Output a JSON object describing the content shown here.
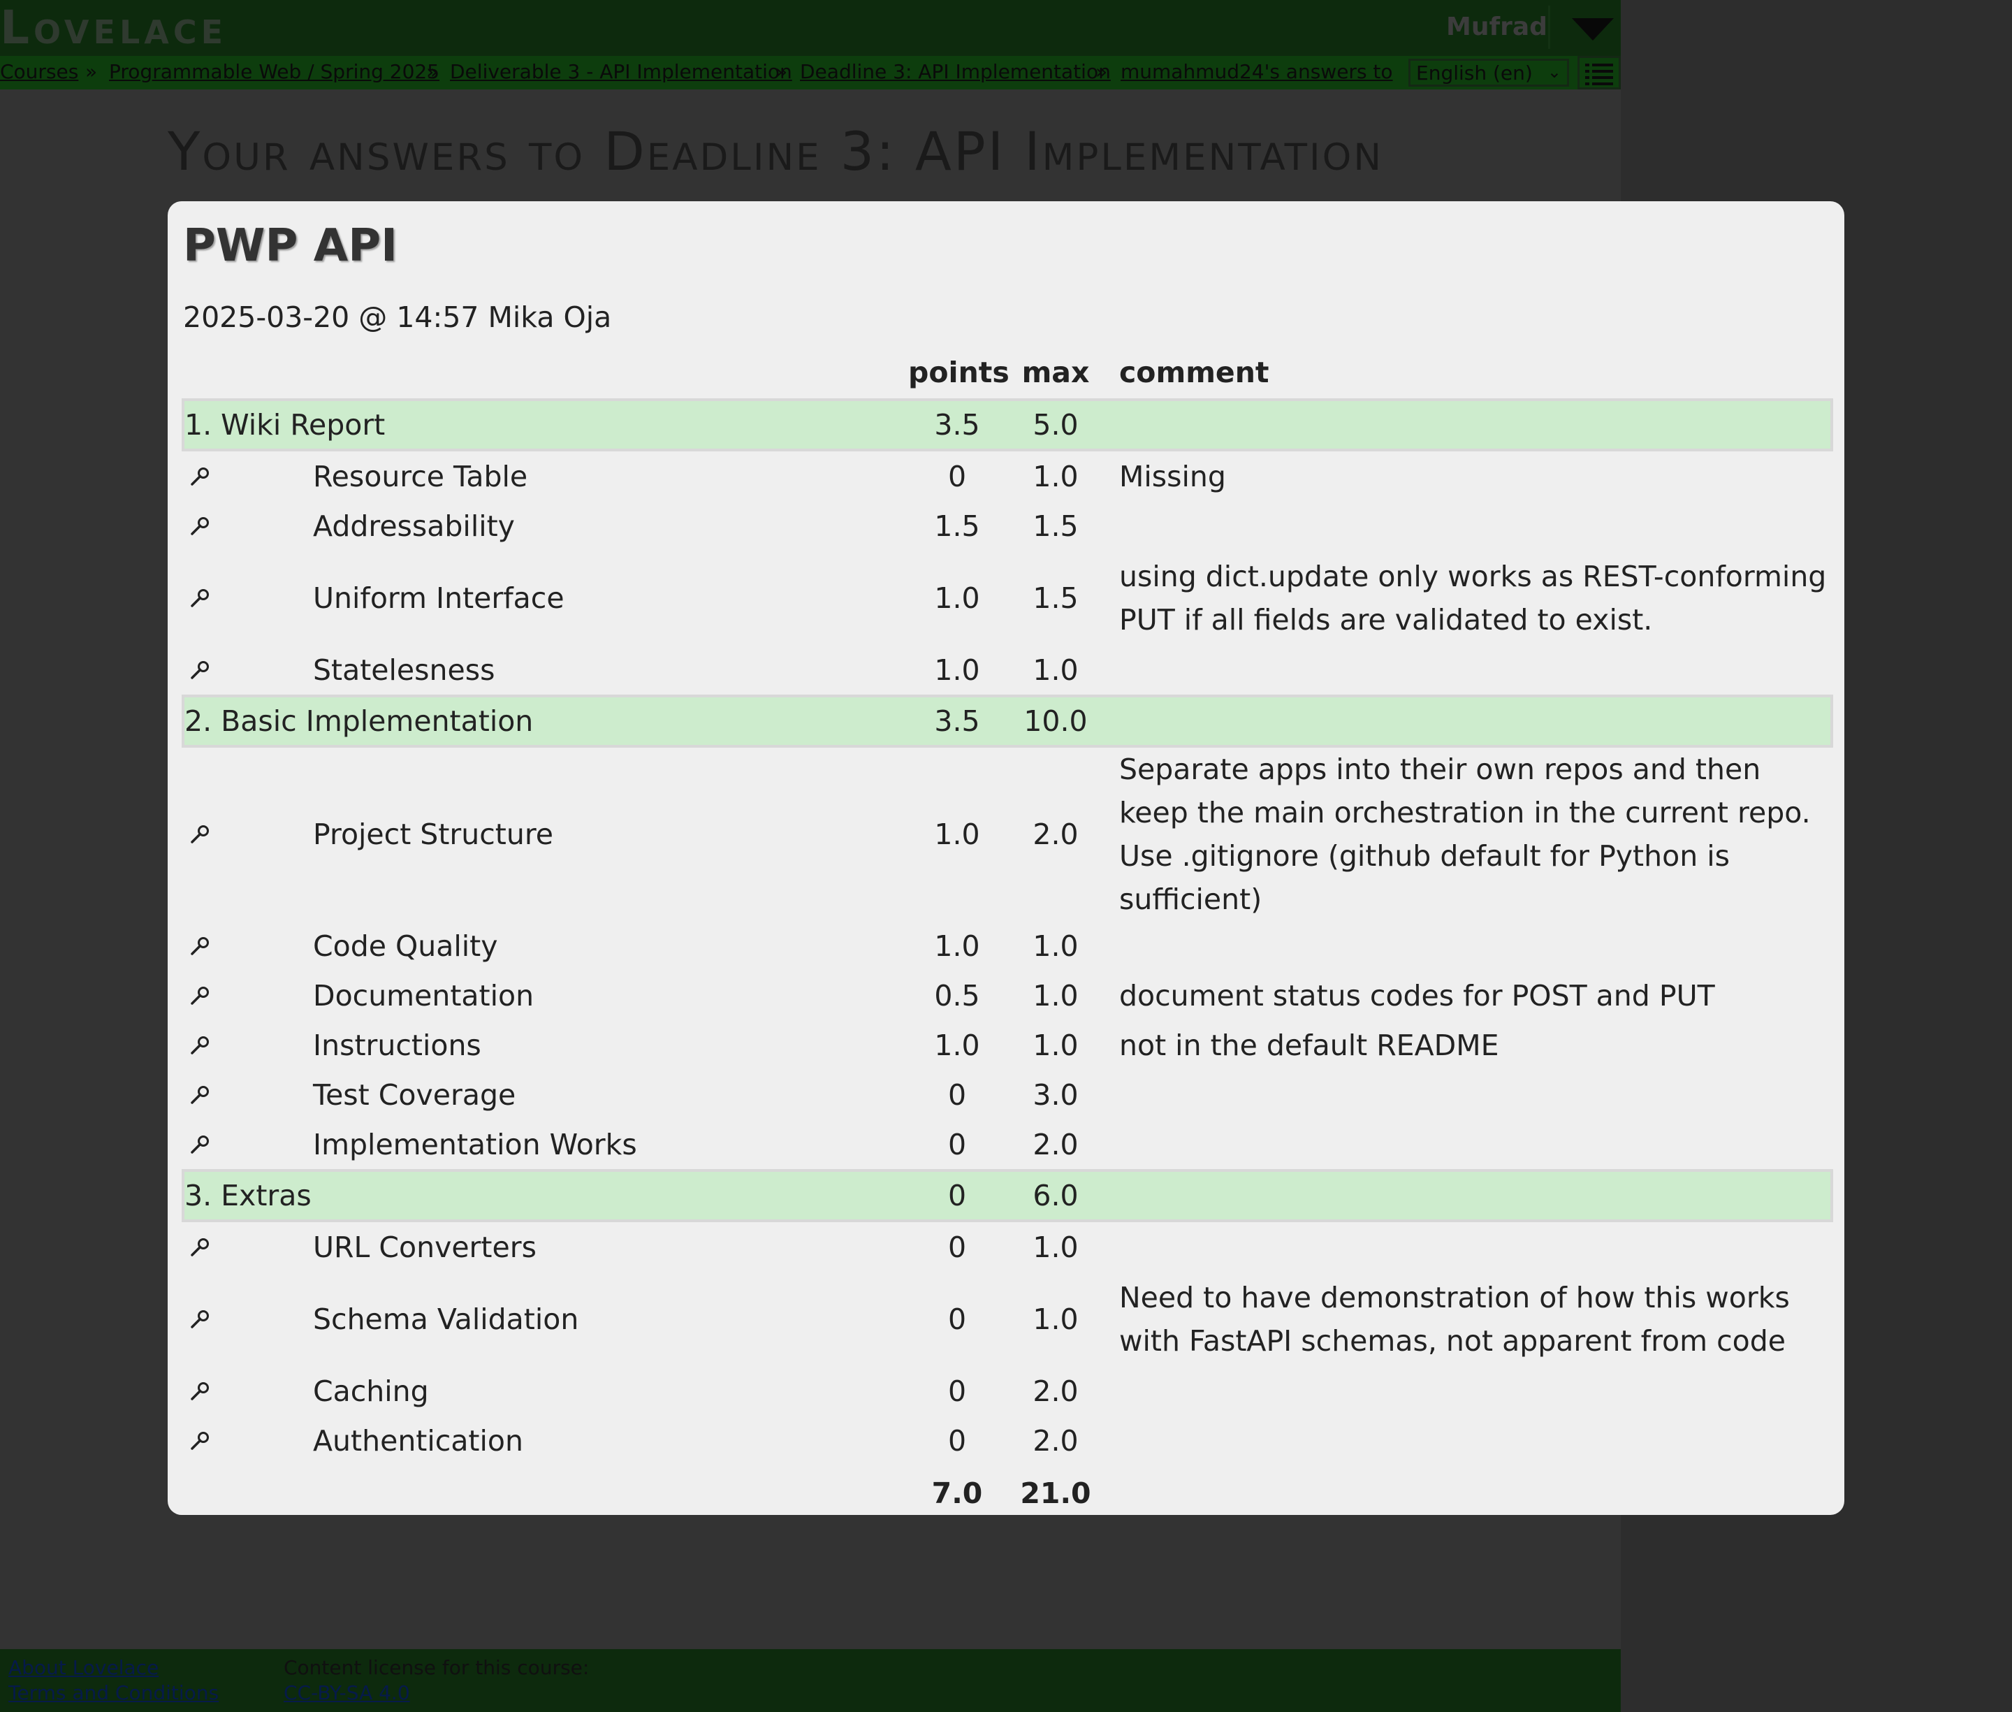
{
  "app": {
    "logo": "Lovelace",
    "user": "Mufrad"
  },
  "breadcrumbs": [
    "Courses",
    "Programmable Web / Spring 2025",
    "Deliverable 3 - API Implementation",
    "Deadline 3: API Implementation",
    "mumahmud24's answers to"
  ],
  "breadcrumb_separator": "»",
  "language": {
    "selected": "English (en)"
  },
  "page": {
    "title": "Your answers to Deadline 3: API Implementation"
  },
  "footer": {
    "about": "About Lovelace",
    "terms": "Terms and Conditions",
    "license_label": "Content license for this course:",
    "license_link": "CC-BY-SA 4.0"
  },
  "modal": {
    "title": "PWP API",
    "meta": "2025-03-20 @ 14:57 Mika Oja",
    "columns": {
      "points": "points",
      "max": "max",
      "comment": "comment"
    },
    "rows": [
      {
        "kind": "section",
        "name": "1. Wiki Report",
        "points": "3.5",
        "max": "5.0",
        "comment": ""
      },
      {
        "kind": "item",
        "name": "Resource Table",
        "points": "0",
        "max": "1.0",
        "comment": "Missing"
      },
      {
        "kind": "item",
        "name": "Addressability",
        "points": "1.5",
        "max": "1.5",
        "comment": ""
      },
      {
        "kind": "item",
        "name": "Uniform Interface",
        "points": "1.0",
        "max": "1.5",
        "comment": "using dict.update only works as REST-conforming PUT if all fields are validated to exist."
      },
      {
        "kind": "item",
        "name": "Statelesness",
        "points": "1.0",
        "max": "1.0",
        "comment": ""
      },
      {
        "kind": "section",
        "name": "2. Basic Implementation",
        "points": "3.5",
        "max": "10.0",
        "comment": ""
      },
      {
        "kind": "item",
        "name": "Project Structure",
        "points": "1.0",
        "max": "2.0",
        "comment": "Separate apps into their own repos and then keep the main orchestration in the current repo. Use .gitignore (github default for Python is sufficient)"
      },
      {
        "kind": "item",
        "name": "Code Quality",
        "points": "1.0",
        "max": "1.0",
        "comment": ""
      },
      {
        "kind": "item",
        "name": "Documentation",
        "points": "0.5",
        "max": "1.0",
        "comment": "document status codes for POST and PUT"
      },
      {
        "kind": "item",
        "name": "Instructions",
        "points": "1.0",
        "max": "1.0",
        "comment": "not in the default README"
      },
      {
        "kind": "item",
        "name": "Test Coverage",
        "points": "0",
        "max": "3.0",
        "comment": ""
      },
      {
        "kind": "item",
        "name": "Implementation Works",
        "points": "0",
        "max": "2.0",
        "comment": ""
      },
      {
        "kind": "section",
        "name": "3. Extras",
        "points": "0",
        "max": "6.0",
        "comment": ""
      },
      {
        "kind": "item",
        "name": "URL Converters",
        "points": "0",
        "max": "1.0",
        "comment": ""
      },
      {
        "kind": "item",
        "name": "Schema Validation",
        "points": "0",
        "max": "1.0",
        "comment": "Need to have demonstration of how this works with FastAPI schemas, not apparent from code"
      },
      {
        "kind": "item",
        "name": "Caching",
        "points": "0",
        "max": "2.0",
        "comment": ""
      },
      {
        "kind": "item",
        "name": "Authentication",
        "points": "0",
        "max": "2.0",
        "comment": ""
      }
    ],
    "total": {
      "points": "7.0",
      "max": "21.0"
    }
  },
  "icons": {
    "item_icon": "magnifier-icon",
    "user_menu_icon": "caret-down-icon",
    "menu_icon": "list-menu-icon"
  },
  "colors": {
    "section_row": "#cdeccd",
    "topbar": "#0d2a0d",
    "crumbbar": "#0d3d0d",
    "modal_bg": "#efefef"
  }
}
